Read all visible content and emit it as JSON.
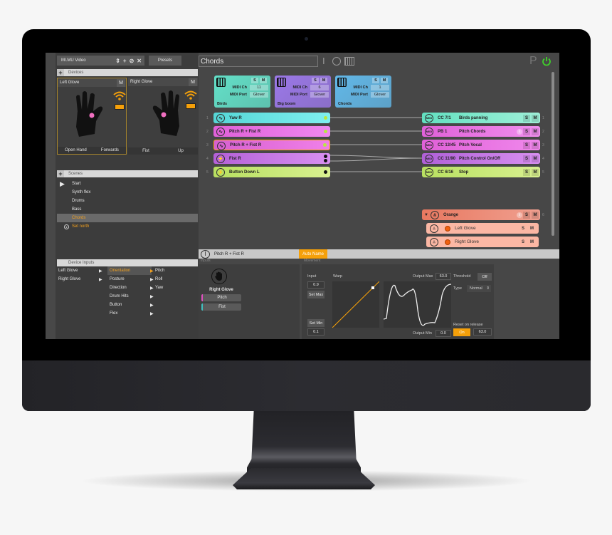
{
  "app": {
    "project_name": "MI.MU Video",
    "project_icons": [
      "updown-icon",
      "plus-icon",
      "link-icon",
      "close-icon"
    ],
    "presets_label": "Presets",
    "scene_title": "Chords",
    "toolbar_icons": [
      "text-cursor-icon",
      "circle-icon",
      "piano-icon"
    ],
    "p_label": "P",
    "power_color": "#3fd12a"
  },
  "devices": {
    "header": "Devices",
    "gloves": [
      {
        "name": "Left Glove",
        "m": "M",
        "posture": "Open Hand",
        "direction": "Forwards",
        "selected": true
      },
      {
        "name": "Right Glove",
        "m": "M",
        "posture": "Fist",
        "direction": "Up",
        "selected": false
      }
    ]
  },
  "scenes": {
    "header": "Scenes",
    "items": [
      {
        "label": "Start",
        "playing": true
      },
      {
        "label": "Synth flex"
      },
      {
        "label": "Drums"
      },
      {
        "label": "Bass"
      },
      {
        "label": "Chords",
        "active": true
      },
      {
        "label": "Set north",
        "action": true
      }
    ]
  },
  "device_inputs": {
    "header": "Device Inputs",
    "devices": [
      "Left Glove",
      "Right Glove"
    ],
    "categories": [
      "Orientation",
      "Posture",
      "Direction",
      "Drum Hits",
      "Button",
      "Flex"
    ],
    "selected_category": "Orientation",
    "sub_items": [
      "Pitch",
      "Roll",
      "Yaw"
    ]
  },
  "outputs_cards": [
    {
      "name": "Birds",
      "s": "S",
      "m": "M",
      "midi_ch_label": "MIDI Ch",
      "midi_ch": "11",
      "midi_port_label": "MIDI Port",
      "midi_port": "Glover",
      "color": "#63e0c8"
    },
    {
      "name": "Big boom",
      "s": "S",
      "m": "M",
      "midi_ch_label": "MIDI Ch",
      "midi_ch": "6",
      "midi_port_label": "MIDI Port",
      "midi_port": "Glover",
      "color": "#9b78e8"
    },
    {
      "name": "Chords",
      "s": "S",
      "m": "M",
      "midi_ch_label": "MIDI Ch",
      "midi_ch": "1",
      "midi_port_label": "MIDI Port",
      "midi_port": "Glover",
      "color": "#62b8e8"
    }
  ],
  "inputs": [
    {
      "num": "1",
      "label": "Yaw R",
      "icon": "wave-icon",
      "c1": "#55d6d6",
      "c2": "#7ff0f0",
      "dot": "#b8e840"
    },
    {
      "num": "2",
      "label": "Pitch R + Fist R",
      "icon": "wave-icon",
      "c1": "#e060d8",
      "c2": "#f088f0",
      "dot": "#b8e840"
    },
    {
      "num": "3",
      "label": "Pitch R + Fist R",
      "icon": "wave-icon",
      "c1": "#d860d0",
      "c2": "#f080e8",
      "dot": "#b8e840",
      "selected": true
    },
    {
      "num": "4",
      "label": "Fist R",
      "icon": "bolt-icon",
      "c1": "#b460d8",
      "c2": "#d890f0",
      "dot": "#111"
    },
    {
      "num": "5",
      "label": "Button Down L",
      "icon": "bolt-icon",
      "c1": "#b8e060",
      "c2": "#d8f090",
      "dot": "#111"
    }
  ],
  "outputs": [
    {
      "num": "1",
      "cc": "CC 7/1",
      "name": "Birds panning",
      "s": "S",
      "m": "M",
      "info": false,
      "c1": "#62e0c0",
      "c2": "#9ff0d8"
    },
    {
      "num": "2",
      "cc": "PB 1",
      "name": "Pitch Chords",
      "s": "S",
      "m": "M",
      "info": true,
      "c1": "#e060d8",
      "c2": "#f090ee"
    },
    {
      "num": "3",
      "cc": "CC 13/45",
      "name": "Pitch Vocal",
      "s": "S",
      "m": "M",
      "info": false,
      "c1": "#e060d8",
      "c2": "#f088ec"
    },
    {
      "num": "4",
      "cc": "CC 11/90",
      "name": "Pitch Control  On/Off",
      "s": "S",
      "m": "M",
      "info": false,
      "c1": "#b060d8",
      "c2": "#d890f0"
    },
    {
      "num": "5",
      "cc": "CC 6/16",
      "name": "Stop",
      "s": "S",
      "m": "M",
      "info": false,
      "c1": "#b8e060",
      "c2": "#d8f090"
    }
  ],
  "group": {
    "num": "6",
    "name": "Orange",
    "s": "S",
    "m": "M",
    "children": [
      {
        "name": "Left Glove",
        "s": "S",
        "m": "M"
      },
      {
        "name": "Right Glove",
        "s": "S",
        "m": "M"
      }
    ]
  },
  "editor": {
    "name": "Pitch R + Fist R",
    "auto_name": "Auto Name",
    "inputs_label": "Inputs",
    "movement_label": "Movement",
    "device": "Right Glove",
    "input_chips": [
      "Pitch",
      "Fist"
    ],
    "input_label": "Input",
    "input_max": "0.9",
    "set_max": "Set Max",
    "set_min": "Set Min",
    "input_min": "0.1",
    "warp_label": "Warp",
    "output_max_label": "Output Max",
    "output_max": "63.0",
    "output_min_label": "Output Min",
    "output_min": "0.0",
    "threshold_label": "Threshold",
    "threshold": "Off",
    "type_label": "Type",
    "type": "Normal",
    "reset_label": "Reset on release",
    "reset_on": "On",
    "reset_value": "63.0",
    "accent": "#f5a00a"
  }
}
